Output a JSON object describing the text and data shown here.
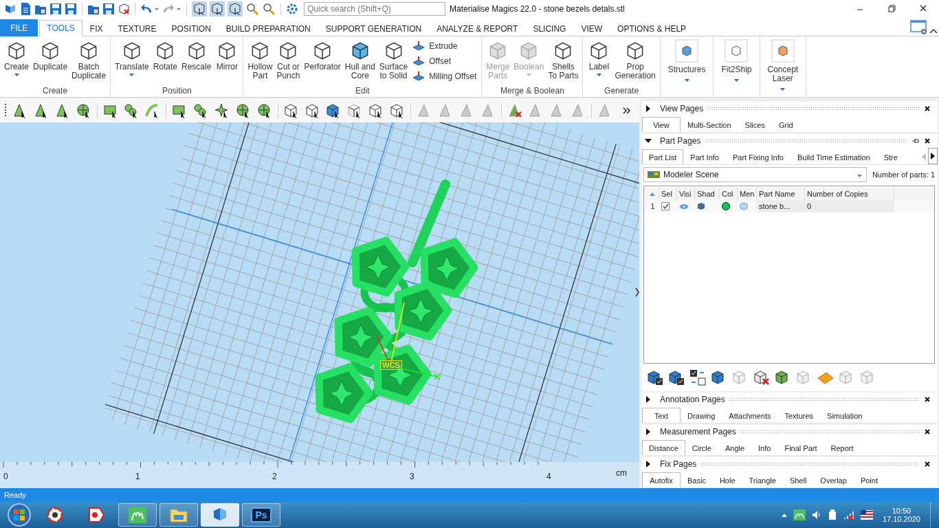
{
  "window": {
    "title": "Materialise Magics 22.0 - stone bezels detals.stl"
  },
  "search": {
    "placeholder": "Quick search (Shift+Q)"
  },
  "ribbon_tabs": [
    {
      "label": "FILE",
      "kind": "file",
      "selected": false
    },
    {
      "label": "TOOLS",
      "kind": "tab",
      "selected": true
    },
    {
      "label": "FIX",
      "kind": "tab",
      "selected": false
    },
    {
      "label": "TEXTURE",
      "kind": "tab",
      "selected": false
    },
    {
      "label": "POSITION",
      "kind": "tab",
      "selected": false
    },
    {
      "label": "BUILD PREPARATION",
      "kind": "tab",
      "selected": false
    },
    {
      "label": "SUPPORT GENERATION",
      "kind": "tab",
      "selected": false
    },
    {
      "label": "ANALYZE & REPORT",
      "kind": "tab",
      "selected": false
    },
    {
      "label": "SLICING",
      "kind": "tab",
      "selected": false
    },
    {
      "label": "VIEW",
      "kind": "tab",
      "selected": false
    },
    {
      "label": "OPTIONS & HELP",
      "kind": "tab",
      "selected": false
    }
  ],
  "ribbon_groups": [
    {
      "label": "Create",
      "buttons": [
        {
          "kind": "large",
          "label": "Create",
          "dropdown": true,
          "disabled": false
        },
        {
          "kind": "large",
          "label": "Duplicate",
          "dropdown": false,
          "disabled": false
        },
        {
          "kind": "large",
          "label": "Batch\nDuplicate",
          "dropdown": false,
          "disabled": false
        }
      ]
    },
    {
      "label": "Position",
      "buttons": [
        {
          "kind": "large",
          "label": "Translate",
          "dropdown": true,
          "disabled": false
        },
        {
          "kind": "large",
          "label": "Rotate",
          "dropdown": false,
          "disabled": false
        },
        {
          "kind": "large",
          "label": "Rescale",
          "dropdown": false,
          "disabled": false
        },
        {
          "kind": "large",
          "label": "Mirror",
          "dropdown": false,
          "disabled": false
        }
      ]
    },
    {
      "label": "Edit",
      "buttons": [
        {
          "kind": "large",
          "label": "Hollow\nPart",
          "dropdown": false,
          "disabled": false
        },
        {
          "kind": "large",
          "label": "Cut or\nPunch",
          "dropdown": false,
          "disabled": false
        },
        {
          "kind": "large",
          "label": "Perforator",
          "dropdown": false,
          "disabled": false
        },
        {
          "kind": "large",
          "label": "Hull and\nCore",
          "dropdown": false,
          "disabled": false
        },
        {
          "kind": "large",
          "label": "Surface\nto Solid",
          "dropdown": false,
          "disabled": false
        },
        {
          "kind": "small",
          "label": "Extrude",
          "disabled": false
        },
        {
          "kind": "small",
          "label": "Offset",
          "disabled": false
        },
        {
          "kind": "small",
          "label": "Milling Offset",
          "disabled": false
        }
      ]
    },
    {
      "label": "Merge & Boolean",
      "buttons": [
        {
          "kind": "large",
          "label": "Merge\nParts",
          "dropdown": false,
          "disabled": true
        },
        {
          "kind": "large",
          "label": "Boolean",
          "dropdown": true,
          "disabled": true
        },
        {
          "kind": "large",
          "label": "Shells\nTo Parts",
          "dropdown": false,
          "disabled": false
        }
      ]
    },
    {
      "label": "Generate",
      "buttons": [
        {
          "kind": "large",
          "label": "Label",
          "dropdown": true,
          "disabled": false
        },
        {
          "kind": "large",
          "label": "Prop\nGeneration",
          "dropdown": false,
          "disabled": false
        }
      ]
    },
    {
      "buttons": [
        {
          "kind": "plugin",
          "label": "Structures",
          "dropdown": true,
          "disabled": false
        }
      ]
    },
    {
      "buttons": [
        {
          "kind": "plugin",
          "label": "Fit2Ship",
          "dropdown": true,
          "disabled": false
        }
      ]
    },
    {
      "buttons": [
        {
          "kind": "plugin",
          "label": "Concept\nLaser",
          "dropdown": true,
          "disabled": false
        }
      ]
    }
  ],
  "viewport": {
    "wcs_label": "WCS",
    "ruler": {
      "ticks": [
        "0",
        "1",
        "2",
        "3",
        "4"
      ],
      "unit": "cm"
    }
  },
  "panel_sections": [
    {
      "kind": "tabs",
      "title": "View Pages",
      "expanded": false,
      "pinnable": false,
      "tabs": [
        {
          "label": "View",
          "selected": true
        },
        {
          "label": "Multi-Section",
          "selected": false
        },
        {
          "label": "Slices",
          "selected": false
        },
        {
          "label": "Grid",
          "selected": false
        }
      ]
    },
    {
      "kind": "parts",
      "title": "Part Pages",
      "expanded": true,
      "pinnable": true,
      "tabs": [
        {
          "label": "Part List",
          "selected": true
        },
        {
          "label": "Part Info",
          "selected": false
        },
        {
          "label": "Part Fixing Info",
          "selected": false
        },
        {
          "label": "Build Time Estimation",
          "selected": false
        },
        {
          "label": "Stre",
          "selected": false
        }
      ]
    },
    {
      "kind": "tabs",
      "title": "Annotation Pages",
      "expanded": false,
      "pinnable": false,
      "tabs": [
        {
          "label": "Text",
          "selected": true
        },
        {
          "label": "Drawing",
          "selected": false
        },
        {
          "label": "Attachments",
          "selected": false
        },
        {
          "label": "Textures",
          "selected": false
        },
        {
          "label": "Simulation",
          "selected": false
        }
      ]
    },
    {
      "kind": "tabs",
      "title": "Measurement Pages",
      "expanded": false,
      "pinnable": false,
      "tabs": [
        {
          "label": "Distance",
          "selected": true
        },
        {
          "label": "Circle",
          "selected": false
        },
        {
          "label": "Angle",
          "selected": false
        },
        {
          "label": "Info",
          "selected": false
        },
        {
          "label": "Final Part",
          "selected": false
        },
        {
          "label": "Report",
          "selected": false
        }
      ]
    },
    {
      "kind": "tabs",
      "title": "Fix Pages",
      "expanded": false,
      "pinnable": false,
      "tabs": [
        {
          "label": "Autofix",
          "selected": true
        },
        {
          "label": "Basic",
          "selected": false
        },
        {
          "label": "Hole",
          "selected": false
        },
        {
          "label": "Triangle",
          "selected": false
        },
        {
          "label": "Shell",
          "selected": false
        },
        {
          "label": "Overlap",
          "selected": false
        },
        {
          "label": "Point",
          "selected": false
        }
      ]
    }
  ],
  "part_list": {
    "scene": "Modeler Scene",
    "count_label": "Number of parts: 1",
    "columns": [
      "Sel",
      "Visi",
      "Shad",
      "Col",
      "Men",
      "Part Name",
      "Number of Copies"
    ],
    "rows": [
      {
        "index": "1",
        "selected": true,
        "visible": true,
        "color": "#00cc55",
        "name": "stone b...",
        "copies": "0"
      }
    ]
  },
  "status_bar": {
    "text": "Ready"
  },
  "taskbar": {
    "apps": [
      {
        "kind": "circle-app",
        "running": false,
        "selected": false
      },
      {
        "kind": "browser",
        "running": false,
        "selected": false
      },
      {
        "kind": "m-app",
        "running": true,
        "selected": false
      },
      {
        "kind": "folder",
        "running": true,
        "selected": false
      },
      {
        "kind": "magics",
        "running": true,
        "selected": true
      },
      {
        "kind": "ps",
        "running": true,
        "selected": false,
        "label": "Ps"
      }
    ],
    "time": "10:50",
    "date": "17.10.2020"
  }
}
